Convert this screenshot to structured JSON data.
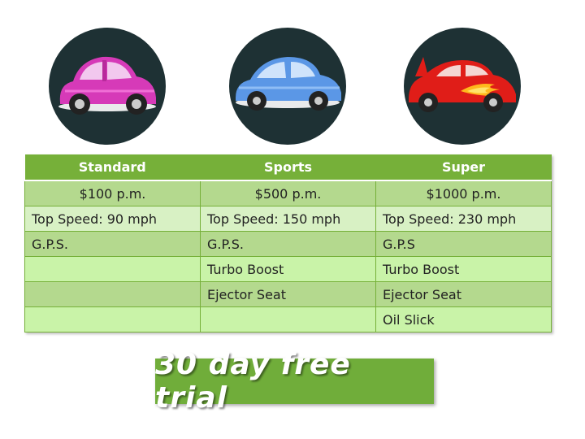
{
  "plans": [
    {
      "name": "Standard",
      "icon": "pink-beetle-car-icon",
      "color": "#d63ab8"
    },
    {
      "name": "Sports",
      "icon": "blue-sports-car-icon",
      "color": "#5b97e6"
    },
    {
      "name": "Super",
      "icon": "red-flame-supercar-icon",
      "color": "#e01d18"
    }
  ],
  "table": {
    "header": [
      "Standard",
      "Sports",
      "Super"
    ],
    "rows": [
      [
        "$100 p.m.",
        "$500 p.m.",
        "$1000 p.m."
      ],
      [
        "Top Speed: 90 mph",
        "Top Speed: 150 mph",
        "Top Speed: 230 mph"
      ],
      [
        "G.P.S.",
        "G.P.S.",
        "G.P.S"
      ],
      [
        "",
        "Turbo Boost",
        "Turbo Boost"
      ],
      [
        "",
        "Ejector Seat",
        "Ejector Seat"
      ],
      [
        "",
        "",
        "Oil Slick"
      ]
    ]
  },
  "banner": {
    "text": "30 day free trial",
    "color": "#70ad3a"
  },
  "colors": {
    "header_green": "#76b039",
    "circle_dark": "#1e3134"
  }
}
